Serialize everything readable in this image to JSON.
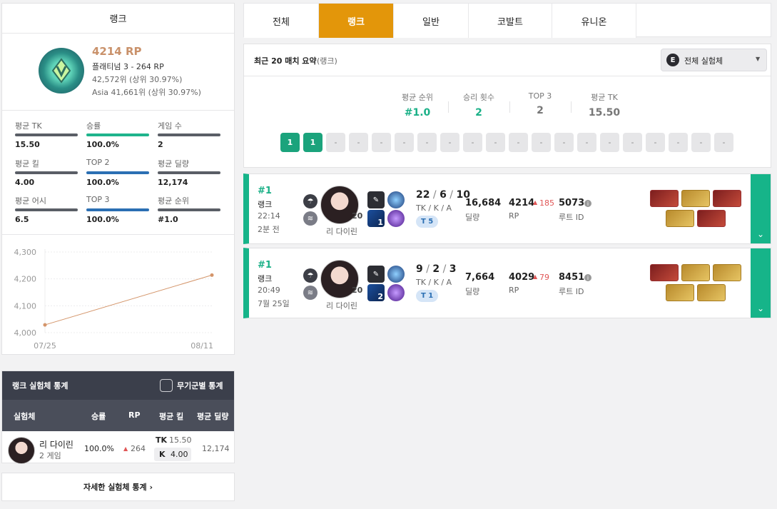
{
  "rank_card": {
    "header": "랭크",
    "rp": "4214 RP",
    "tier": "플래티넘 3 - 264 RP",
    "rank_global": "42,572위 (상위 30.97%)",
    "rank_asia": "Asia 41,661위 (상위 30.97%)"
  },
  "stats": [
    {
      "label": "평균 TK",
      "value": "15.50",
      "color": "dark"
    },
    {
      "label": "승률",
      "value": "100.0%",
      "color": "green"
    },
    {
      "label": "게임 수",
      "value": "2",
      "color": "dark"
    },
    {
      "label": "평균 킬",
      "value": "4.00",
      "color": "dark"
    },
    {
      "label": "TOP 2",
      "value": "100.0%",
      "color": "blue"
    },
    {
      "label": "평균 딜량",
      "value": "12,174",
      "color": "dark"
    },
    {
      "label": "평균 어시",
      "value": "6.5",
      "color": "dark"
    },
    {
      "label": "TOP 3",
      "value": "100.0%",
      "color": "blue"
    },
    {
      "label": "평균 순위",
      "value": "#1.0",
      "color": "dark"
    }
  ],
  "chart_data": {
    "type": "line",
    "x": [
      "07/25",
      "08/11"
    ],
    "values": [
      4029,
      4214
    ],
    "yticks": [
      "4,300",
      "4,200",
      "4,100",
      "4,000"
    ],
    "ylim": [
      4000,
      4300
    ],
    "grid": true,
    "color": "#d4956a"
  },
  "char_stats": {
    "title": "랭크 실험체 통계",
    "weapon_toggle": "무기군별 통계",
    "columns": [
      "실험체",
      "승률",
      "RP",
      "평균 킬",
      "평균 딜량"
    ],
    "rows": [
      {
        "name": "리 다이린",
        "games": "2 게임",
        "winrate": "100.0%",
        "rp": "264",
        "tk_label": "TK",
        "tk": "15.50",
        "k_label": "K",
        "k": "4.00",
        "damage": "12,174"
      }
    ],
    "more": "자세한 실험체 통계 ›"
  },
  "tabs": [
    "전체",
    "랭크",
    "일반",
    "코발트",
    "유니온"
  ],
  "summary": {
    "title": "최근 20 매치 요약",
    "title_sub": "(랭크)",
    "filter_badge": "E",
    "filter": "전체 실험체",
    "stats": [
      {
        "label": "평균 순위",
        "value": "#1.0",
        "color": "green"
      },
      {
        "label": "승리 횟수",
        "value": "2",
        "color": "green"
      },
      {
        "label": "TOP 3",
        "value": "2",
        "color": "gray"
      },
      {
        "label": "평균 TK",
        "value": "15.50",
        "color": "gray"
      }
    ],
    "pills": [
      "1",
      "1",
      "-",
      "-",
      "-",
      "-",
      "-",
      "-",
      "-",
      "-",
      "-",
      "-",
      "-",
      "-",
      "-",
      "-",
      "-",
      "-",
      "-",
      "-"
    ]
  },
  "matches": [
    {
      "rank": "#1",
      "mode": "랭크",
      "time": "22:14",
      "ago": "2분 전",
      "level": "20",
      "char": "리 다이린",
      "skill_num": "1",
      "kda_k": "22",
      "kda_d": "6",
      "kda_a": "10",
      "kda_label": "TK / K / A",
      "team": "T 5",
      "damage": "16,684",
      "damage_label": "딜량",
      "rp": "4214",
      "rp_delta": "185",
      "rp_label": "RP",
      "route": "5073",
      "route_label": "루트 ID",
      "weather1": "rain-icon",
      "weather2": "wind-icon"
    },
    {
      "rank": "#1",
      "mode": "랭크",
      "time": "20:49",
      "ago": "7월 25일",
      "level": "20",
      "char": "리 다이린",
      "skill_num": "2",
      "kda_k": "9",
      "kda_d": "2",
      "kda_a": "3",
      "kda_label": "TK / K / A",
      "team": "T 1",
      "damage": "7,664",
      "damage_label": "딜량",
      "rp": "4029",
      "rp_delta": "79",
      "rp_label": "RP",
      "route": "8451",
      "route_label": "루트 ID",
      "weather1": "rain-icon",
      "weather2": "wind-icon"
    }
  ]
}
